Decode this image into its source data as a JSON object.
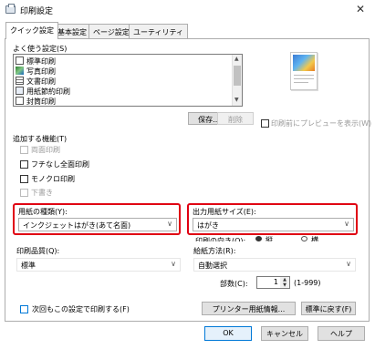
{
  "window": {
    "title": "印刷設定",
    "close_glyph": "✕"
  },
  "tabs": [
    {
      "label": "クイック設定",
      "active": true
    },
    {
      "label": "基本設定",
      "active": false
    },
    {
      "label": "ページ設定",
      "active": false
    },
    {
      "label": "ユーティリティ",
      "active": false
    }
  ],
  "favorites": {
    "label": "よく使う設定(S)",
    "items": [
      {
        "label": "標準印刷",
        "selected": false
      },
      {
        "label": "写真印刷",
        "selected": false
      },
      {
        "label": "文書印刷",
        "selected": false
      },
      {
        "label": "用紙節約印刷",
        "selected": false
      },
      {
        "label": "封筒印刷",
        "selected": false
      }
    ],
    "save_button": "保存...",
    "delete_button": "削除"
  },
  "preview_checkbox": {
    "label": "印刷前にプレビューを表示(W)",
    "checked": false
  },
  "additional": {
    "label": "追加する機能(T)",
    "items": [
      {
        "label": "両面印刷",
        "checked": false,
        "disabled": true
      },
      {
        "label": "フチなし全面印刷",
        "checked": false,
        "disabled": false
      },
      {
        "label": "モノクロ印刷",
        "checked": false,
        "disabled": false
      },
      {
        "label": "下書き",
        "checked": false,
        "disabled": true
      }
    ]
  },
  "media_type": {
    "label": "用紙の種類(Y):",
    "value": "インクジェットはがき(あて名面)"
  },
  "output_size": {
    "label": "出力用紙サイズ(E):",
    "value": "はがき"
  },
  "orientation": {
    "label": "印刷の向き(O):",
    "portrait": "縦",
    "landscape": "横"
  },
  "quality": {
    "label": "印刷品質(Q):",
    "value": "標準"
  },
  "feed": {
    "label": "給紙方法(R):",
    "value": "自動選択"
  },
  "copies": {
    "label": "部数(C):",
    "value": "1",
    "range": "(1-999)"
  },
  "always_print": {
    "label": "次回もこの設定で印刷する(F)",
    "checked": false
  },
  "printer_info_button": "プリンター用紙情報...",
  "defaults_button": "標準に戻す(F)",
  "ok_button": "OK",
  "cancel_button": "キャンセル",
  "help_button": "ヘルプ",
  "colors": {
    "highlight_red": "#e00012",
    "accent_blue": "#0078d7"
  }
}
